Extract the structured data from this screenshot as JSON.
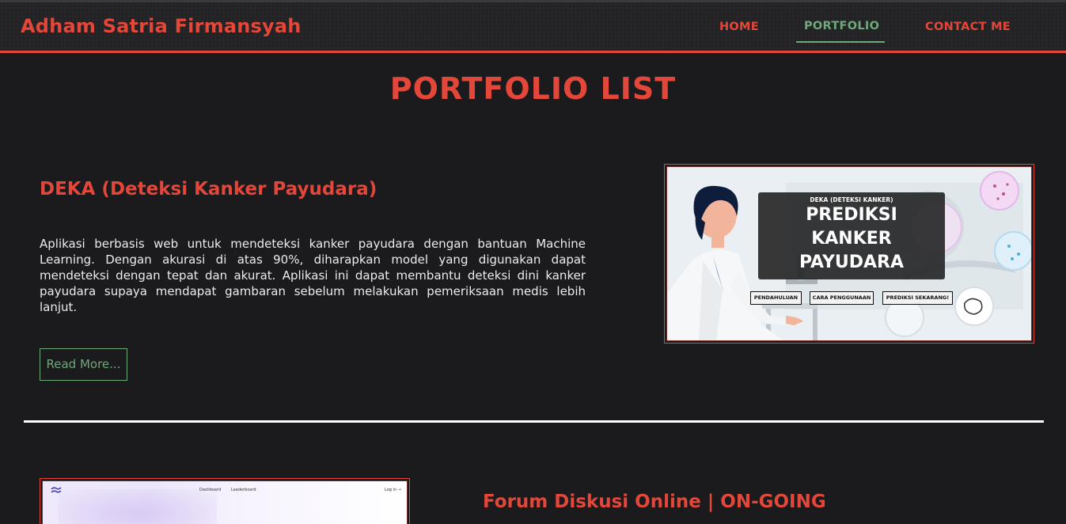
{
  "navbar": {
    "brand": "Adham Satria Firmansyah",
    "links": [
      "HOME",
      "PORTFOLIO",
      "CONTACT ME"
    ],
    "active": "PORTFOLIO"
  },
  "page": {
    "title": "PORTFOLIO LIST"
  },
  "projects": [
    {
      "title": "DEKA (Deteksi Kanker Payudara)",
      "description": "Aplikasi berbasis web untuk mendeteksi kanker payudara dengan bantuan Machine Learning. Dengan akurasi di atas 90%, diharapkan model yang digunakan dapat mendeteksi dengan tepat dan akurat. Aplikasi ini dapat membantu deteksi dini kanker payudara supaya mendapat gambaran sebelum melakukan pemeriksaan medis lebih lanjut.",
      "read_more": "Read More...",
      "image": {
        "overlay_small": "DEKA (DETEKSI KANKER)",
        "overlay_lines": [
          "PREDIKSI",
          "KANKER",
          "PAYUDARA"
        ],
        "buttons": [
          "PENDAHULUAN",
          "CARA PENGGUNAAN",
          "PREDIKSI SEKARANG!"
        ]
      }
    },
    {
      "title": "Forum Diskusi Online | ON-GOING",
      "image": {
        "nav": [
          "Dashboard",
          "Leaderboard",
          "Log in →"
        ]
      }
    }
  ],
  "colors": {
    "accent": "#e2473a",
    "green": "#6ea97c",
    "background": "#1b1a1c"
  }
}
